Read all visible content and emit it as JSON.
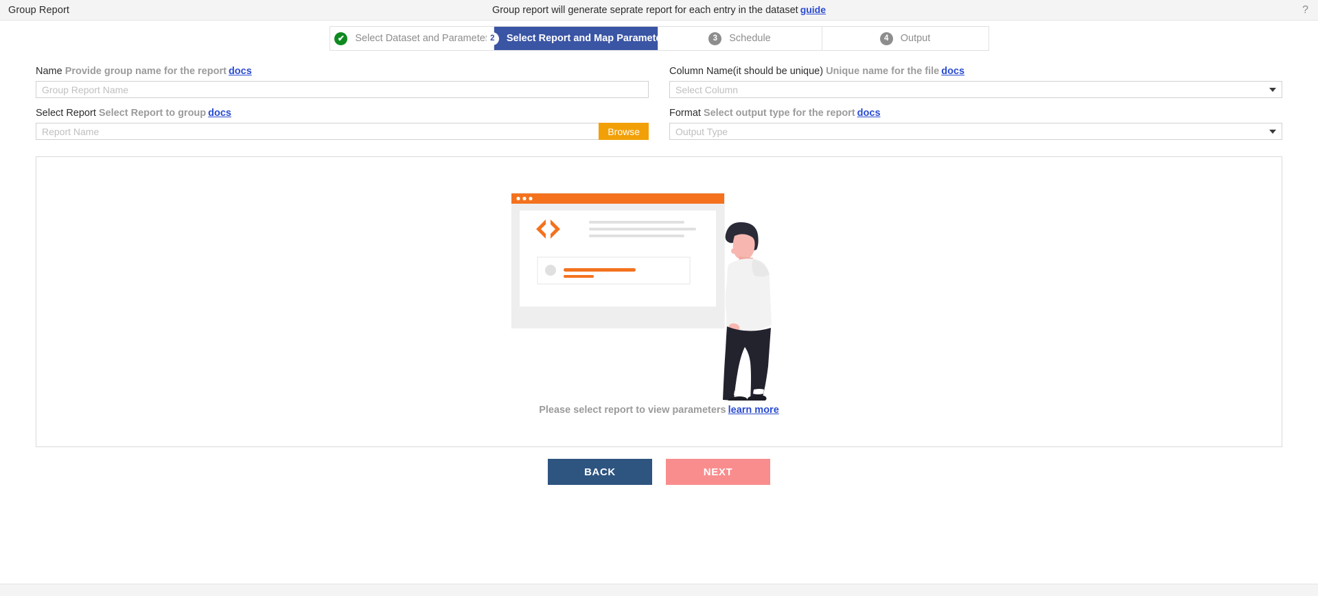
{
  "header": {
    "title": "Group Report",
    "description": "Group report will generate seprate report for each entry in the dataset",
    "guide_label": "guide",
    "help_icon": "question-mark-icon"
  },
  "stepper": {
    "steps": [
      {
        "num": "✔",
        "label": "Select Dataset and Parameter",
        "state": "done"
      },
      {
        "num": "2",
        "label": "Select Report and Map Parameter",
        "state": "active"
      },
      {
        "num": "3",
        "label": "Schedule",
        "state": "pending"
      },
      {
        "num": "4",
        "label": "Output",
        "state": "pending"
      }
    ]
  },
  "form": {
    "name": {
      "label": "Name",
      "hint": "Provide group name for the report",
      "docs": "docs",
      "placeholder": "Group Report Name",
      "value": ""
    },
    "select_report": {
      "label": "Select Report",
      "hint": "Select Report to group",
      "docs": "docs",
      "placeholder": "Report Name",
      "value": "",
      "browse_label": "Browse"
    },
    "column_name": {
      "label": "Column Name(it should be unique)",
      "hint": "Unique name for the file",
      "docs": "docs",
      "placeholder": "Select Column",
      "value": ""
    },
    "format": {
      "label": "Format",
      "hint": "Select output type for the report",
      "docs": "docs",
      "placeholder": "Output Type",
      "value": ""
    }
  },
  "empty_state": {
    "caption": "Please select report to view parameters",
    "learn_more": "learn more",
    "illustration": "developer-window-illustration",
    "colors": {
      "accent_orange": "#f4721e",
      "panel_gray": "#eeeeee",
      "person_dark": "#2b2b38"
    }
  },
  "footer": {
    "back_label": "BACK",
    "next_label": "NEXT",
    "back_color": "#2e5480",
    "next_color": "#f98d8d"
  }
}
